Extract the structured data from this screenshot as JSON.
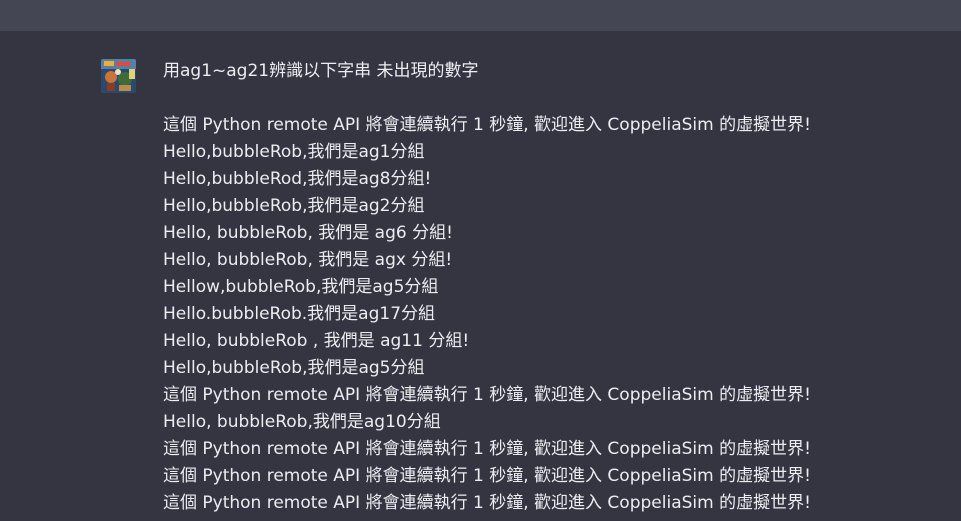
{
  "message": {
    "question": "用ag1~ag21辨識以下字串 未出現的數字",
    "lines": [
      "這個 Python remote API 將會連續執行 1 秒鐘, 歡迎進入 CoppeliaSim 的虛擬世界!",
      "Hello,bubbleRob,我們是ag1分組",
      "Hello,bubbleRod,我們是ag8分組!",
      "Hello,bubbleRob,我們是ag2分組",
      "Hello, bubbleRob, 我們是 ag6 分組!",
      "Hello, bubbleRob, 我們是 agx 分組!",
      "Hellow,bubbleRob,我們是ag5分組",
      "Hello.bubbleRob.我們是ag17分組",
      "Hello, bubbleRob , 我們是 ag11 分組!",
      "Hello,bubbleRob,我們是ag5分組",
      "這個 Python remote API 將會連續執行 1 秒鐘, 歡迎進入 CoppeliaSim 的虛擬世界!",
      "Hello, bubbleRob,我們是ag10分組",
      "這個 Python remote API 將會連續執行 1 秒鐘, 歡迎進入 CoppeliaSim 的虛擬世界!",
      "這個 Python remote API 將會連續執行 1 秒鐘, 歡迎進入 CoppeliaSim 的虛擬世界!",
      "這個 Python remote API 將會連續執行 1 秒鐘, 歡迎進入 CoppeliaSim 的虛擬世界!"
    ]
  },
  "avatar": {
    "icon": "user-avatar-icon"
  },
  "colors": {
    "background": "#343541",
    "topbar": "#444654",
    "text": "#ececf1"
  }
}
